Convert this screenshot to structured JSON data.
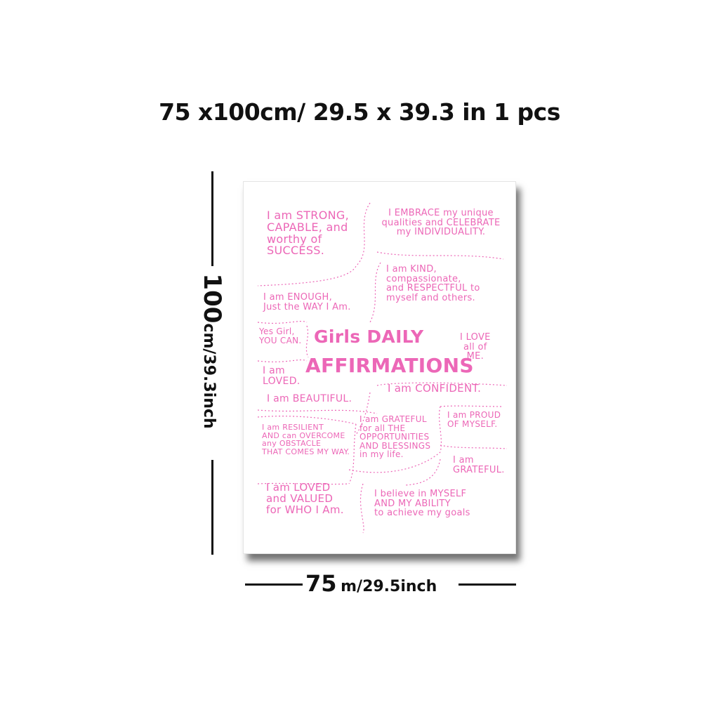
{
  "dimensions": {
    "top_label": "75 x100cm/ 29.5 x 39.3 in 1 pcs",
    "height_main": "100",
    "height_rest": "cm/39.3inch",
    "width_main": "75",
    "width_rest": "m/29.5inch"
  },
  "colors": {
    "accent": "#ec67b7",
    "text": "#111111",
    "background": "#ffffff"
  },
  "poster": {
    "strong": "I am STRONG,\nCAPABLE, and\nworthy of\nSUCCESS.",
    "embrace": "I EMBRACE my unique\nqualities and CELEBRATE\nmy INDIVIDUALITY.",
    "enough": "I am ENOUGH,\nJust the WAY I Am.",
    "kind": "I am KIND,\ncompassionate,\nand RESPECTFUL to\nmyself and others.",
    "yes_girl": "Yes Girl,\nYOU CAN.",
    "title_line1": "Girls DAILY",
    "title_line2": "AFFIRMATIONS",
    "love": "I LOVE\nall of\nME.",
    "loved": "I am\nLOVED.",
    "beautiful": "I am BEAUTIFUL.",
    "confident": "I am CONFIDENT.",
    "resilient": "I am RESILIENT\nAND can OVERCOME\nany OBSTACLE\nTHAT COMES MY WAY.",
    "grateful_for": "I am GRATEFUL\nfor all THE\nOPPORTUNITIES\nAND BLESSINGS\nin my life.",
    "proud": "I am PROUD\nOF MYSELF.",
    "grateful": "I am\nGRATEFUL.",
    "loved_valued": "I am LOVED\nand VALUED\nfor WHO I Am.",
    "believe": "I believe in MYSELF\nAND MY ABILITY\nto achieve my goals"
  }
}
